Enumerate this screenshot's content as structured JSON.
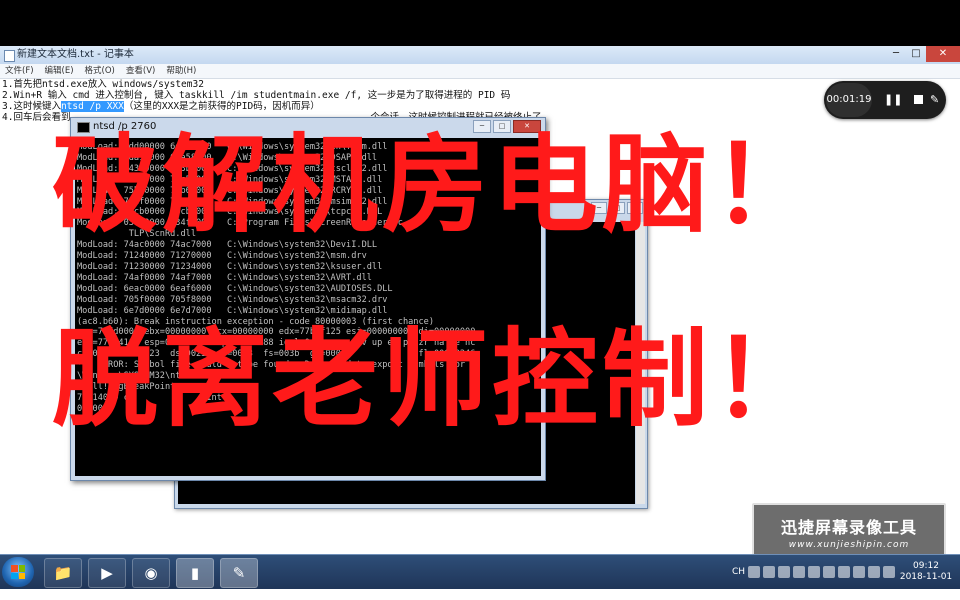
{
  "notepad": {
    "title": "新建文本文档.txt - 记事本",
    "menu": [
      "文件(F)",
      "编辑(E)",
      "格式(O)",
      "查看(V)",
      "帮助(H)"
    ],
    "lines": [
      "1.首先把ntsd.exe放入 windows/system32",
      "2.Win+R 输入 cmd 进入控制台, 键入 taskkill /im studentmain.exe /f, 这一步是为了取得进程的 PID 码",
      "3.这时候键入",
      "4.回车后会看到"
    ],
    "line3_selected": "ntsd /p XXX",
    "line3_rest": "（这里的XXX是之前获得的PID码，因机而异）",
    "line4_rest": "个会话，这时候控制进程就已经被终止了"
  },
  "recorder": {
    "time": "00:01:19"
  },
  "console": {
    "title": "ntsd /p 2760",
    "lines": [
      "ModLoad: 6dd00000 6de16000   C:\\Windows\\system32\\en\\fssm.dll",
      "ModLoad: 6da10000 6da58000   C:\\Windows\\system32\\DSAPI.dll",
      "ModLoad: 74380000 743b0000   C:\\Windows\\system32\\tscli32.dll",
      "ModLoad: 75c30000 75c55000   C:\\Windows\\system32\\MSTASK.dll",
      "ModLoad: 75b60000 75b6c000   C:\\Windows\\system32\\RCRYPT.dll",
      "ModLoad: 751f0000 751f6000   C:\\Windows\\system32\\msimg32.dll",
      "ModLoad: 73cb0000 73cb2000   C:\\Windows\\system32\\tcpcsc.DLL",
      "ModLoad: 03490000 034f0000   C:\\Program Files\\ScreenRecorder\\Sc",
      "          TLP\\ScnRd.dll",
      "ModLoad: 74ac0000 74ac7000   C:\\Windows\\system32\\DeviI.DLL",
      "ModLoad: 71240000 71270000   C:\\Windows\\system32\\msm.drv",
      "ModLoad: 71230000 71234000   C:\\Windows\\system32\\ksuser.dll",
      "ModLoad: 74af0000 74af7000   C:\\Windows\\system32\\AVRT.dll",
      "ModLoad: 6eac0000 6eaf6000   C:\\Windows\\system32\\AUDIOSES.DLL",
      "ModLoad: 705f0000 705f8000   C:\\Windows\\system32\\msacm32.drv",
      "ModLoad: 6e7d0000 6e7d7000   C:\\Windows\\system32\\midimap.dll",
      "(ac8.b60): Break instruction exception - code 80000003 (first chance)",
      "eax=7ffd0000 ebx=00000000 ecx=00000000 edx=77b7f125 esi=00000000 edi=00000000",
      "eip=77b1410c esp=038dff5c ebp=038dff88 iopl=0         nv up ei pl zr na pe nc",
      "cs=001b  ss=0023  ds=0023  es=0023  fs=003b  gs=0000             efl=00000246",
      "*** ERROR: Symbol file could not be found.  Defaulted to export symbols for C:",
      "\\Windows\\SYSTEM32\\ntdll.dll -",
      "ntdll!DbgBreakPoint:",
      "77b140f0 cc              int     3",
      "0:000> "
    ]
  },
  "overlay": {
    "line1": "破解机房电脑！",
    "line2": "脱离老师控制！"
  },
  "watermark": {
    "title": "迅捷屏幕录像工具",
    "url": "www.xunjieshipin.com"
  },
  "taskbar": {
    "ime": "CH",
    "time": "09:12",
    "date": "2018-11-01"
  }
}
